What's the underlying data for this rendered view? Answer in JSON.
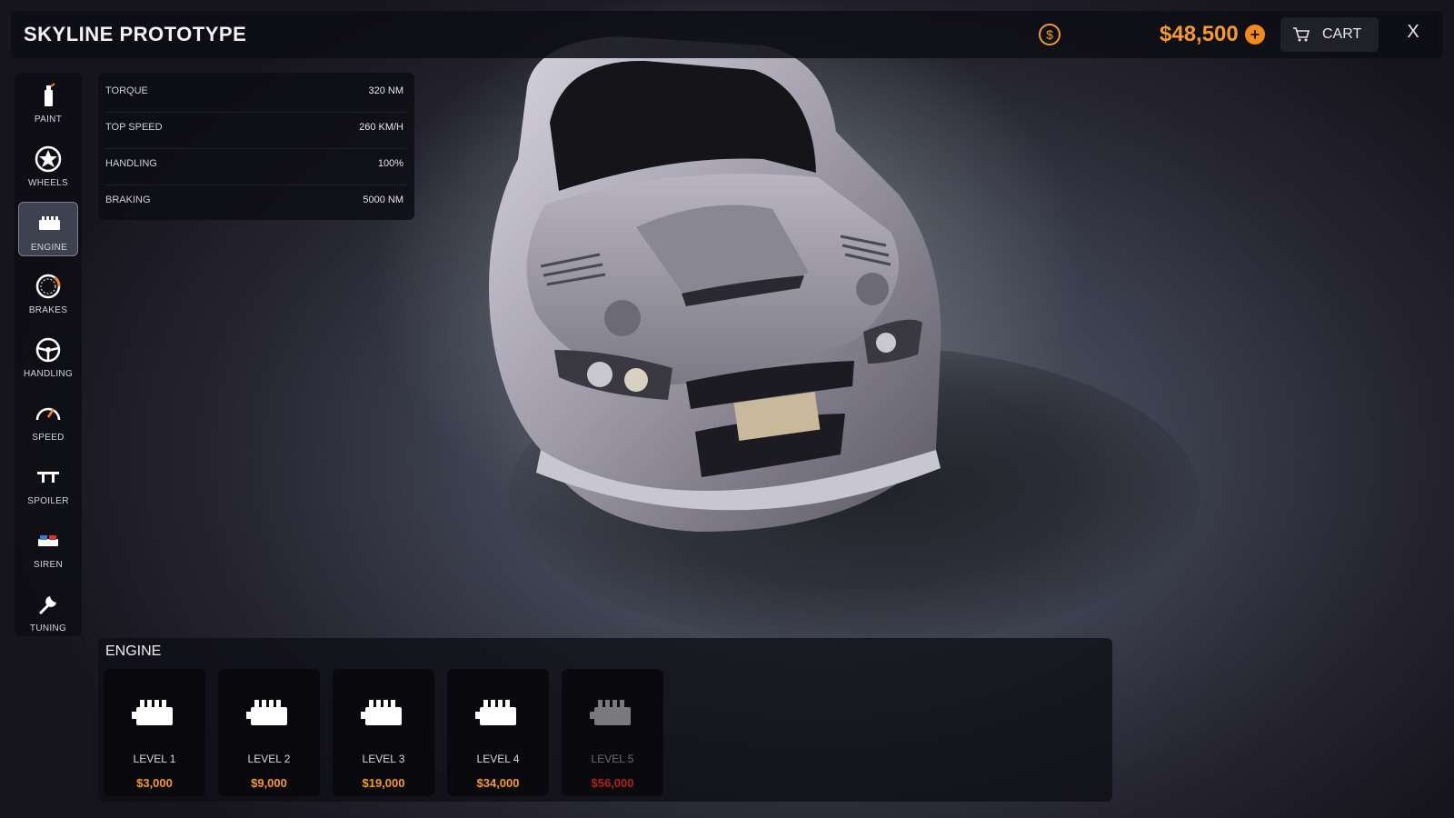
{
  "topbar": {
    "title": "SKYLINE PROTOTYPE",
    "balance": "$48,500",
    "add_funds_label": "+",
    "cart_label": "CART",
    "close_label": "X"
  },
  "icons": {
    "coin": "dollar-coin-icon",
    "cart": "cart-icon",
    "paint": "spray-can-icon",
    "wheels": "wheel-icon",
    "engine": "engine-icon",
    "brakes": "brake-disc-icon",
    "handling": "steering-wheel-icon",
    "speed": "speedometer-icon",
    "spoiler": "spoiler-icon",
    "siren": "siren-icon",
    "tuning": "wrench-icon"
  },
  "colors": {
    "accent": "#f59a2c",
    "locked_price": "#b0231c",
    "active_item_bg": "#464b5a"
  },
  "sidebar": {
    "items": [
      {
        "label": "PAINT",
        "active": false
      },
      {
        "label": "WHEELS",
        "active": false
      },
      {
        "label": "ENGINE",
        "active": true
      },
      {
        "label": "BRAKES",
        "active": false
      },
      {
        "label": "HANDLING",
        "active": false
      },
      {
        "label": "SPEED",
        "active": false
      },
      {
        "label": "SPOILER",
        "active": false
      },
      {
        "label": "SIREN",
        "active": false
      },
      {
        "label": "TUNING",
        "active": false
      }
    ]
  },
  "stats": [
    {
      "label": "TORQUE",
      "value": "320 NM"
    },
    {
      "label": "TOP SPEED",
      "value": "260 KM/H"
    },
    {
      "label": "HANDLING",
      "value": "100%"
    },
    {
      "label": "BRAKING",
      "value": "5000 NM"
    }
  ],
  "upgrades": {
    "title": "ENGINE",
    "cards": [
      {
        "level": "LEVEL 1",
        "price": "$3,000",
        "locked": false
      },
      {
        "level": "LEVEL 2",
        "price": "$9,000",
        "locked": false
      },
      {
        "level": "LEVEL 3",
        "price": "$19,000",
        "locked": false
      },
      {
        "level": "LEVEL 4",
        "price": "$34,000",
        "locked": false
      },
      {
        "level": "LEVEL 5",
        "price": "$56,000",
        "locked": true
      }
    ]
  }
}
